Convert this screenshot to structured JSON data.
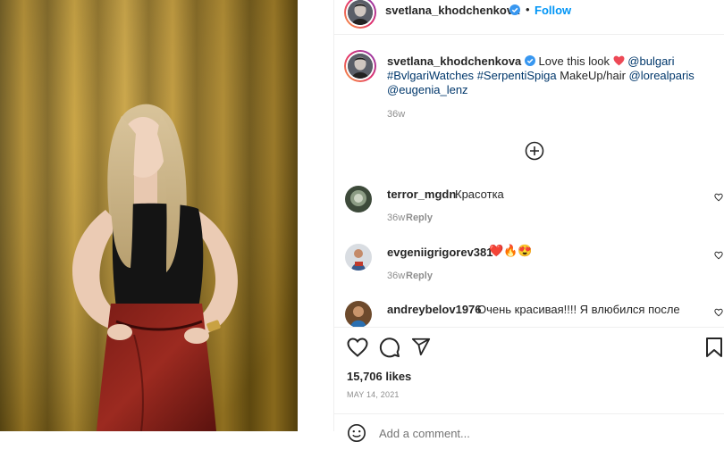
{
  "post": {
    "author": "svetlana_khodchenkova",
    "follow_separator": "•",
    "follow_label": "Follow"
  },
  "caption": {
    "author": "svetlana_khodchenkova",
    "text_before": "Love this look",
    "mention_brand": "@bulgari",
    "hashtag_1": "#BvlgariWatches",
    "hashtag_2": "#SerpentiSpiga",
    "text_makeup": "MakeUp/hair",
    "mention_loreal": "@lorealparis",
    "mention_eugenia": "@eugenia_lenz",
    "time": "36w"
  },
  "comments": [
    {
      "user": "terror_mgdn",
      "text": "Красотка",
      "time": "36w",
      "reply": "Reply"
    },
    {
      "user": "evgeniigrigorev381",
      "text": "❤️🔥😍",
      "time": "36w",
      "reply": "Reply"
    },
    {
      "user": "andreybelov1976",
      "text": "Очень красивая!!!! Я влюбился после",
      "time": "",
      "reply": ""
    }
  ],
  "actions": {
    "likes": "15,706 likes",
    "date": "MAY 14, 2021"
  },
  "add_comment": {
    "placeholder": "Add a comment..."
  },
  "colors": {
    "link": "#00376b",
    "verified": "#3897f0",
    "follow": "#0095f6",
    "heart": "#ed4956"
  }
}
